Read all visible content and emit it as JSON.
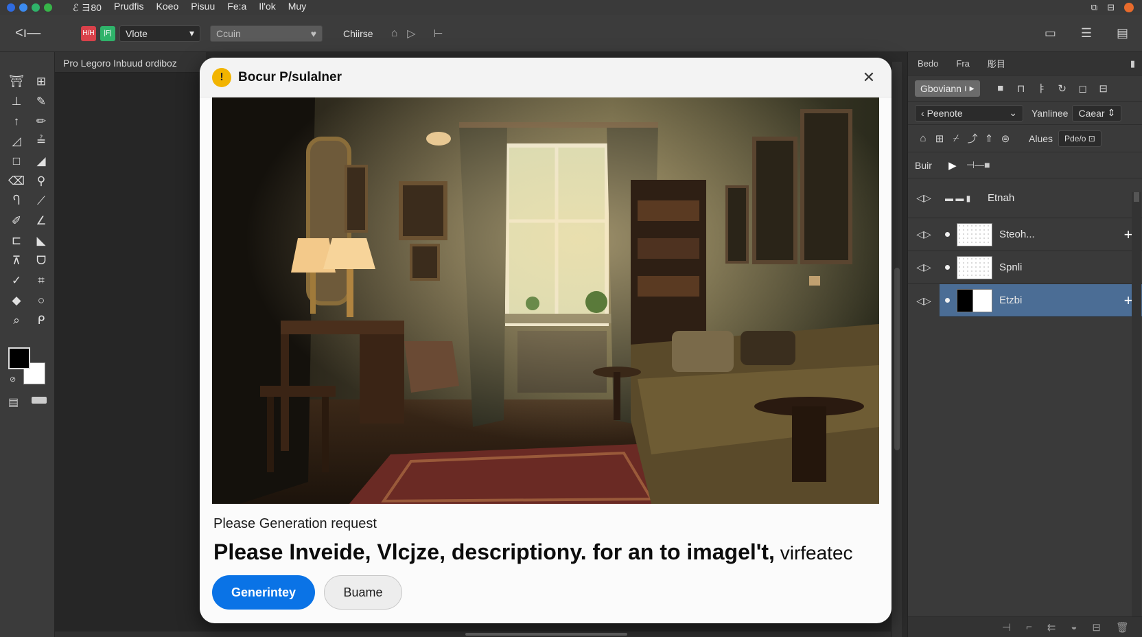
{
  "menubar": {
    "app": "ℰ ヨ80",
    "items": [
      "Prudfis",
      "Koeo",
      "Pisuu",
      "Fe:a",
      "Il'ok",
      "Muy"
    ]
  },
  "options": {
    "mode_value": "Vlote",
    "color_value": "Ccuin",
    "label": "Chiirse",
    "badge_red": "H/H",
    "badge_green": "|F|"
  },
  "document": {
    "tab_title": "Pro Legoro Inbuud ordiboz"
  },
  "dialog": {
    "title": "Bocur P/sulalner",
    "prompt_label": "Please Generation request",
    "prompt_text": "Please Inveide, Vlcjze, descriptiony. for an to imagel't,",
    "prompt_suffix": " virfeatec",
    "primary_button": "Generintey",
    "secondary_button": "Buame",
    "icon": "warning-icon"
  },
  "right_panel": {
    "tabs": [
      "Bedo",
      "Fra",
      "彫目"
    ],
    "row1_pill": "Gboviann",
    "row2_select": "Peenote",
    "row2_label": "Yanlinee",
    "row2_right": "Caear",
    "row3_label": "Alues",
    "row3_right": "Pde/o",
    "row4_label": "Buir",
    "layers": [
      {
        "name": "Etnah",
        "selected": false
      },
      {
        "name": "Steoh...",
        "selected": false
      },
      {
        "name": "Spnli",
        "selected": false
      },
      {
        "name": "Etzbi",
        "selected": true
      }
    ]
  },
  "colors": {
    "accent": "#0a73e6",
    "selection": "#4b6d95",
    "warning": "#f2b400"
  }
}
